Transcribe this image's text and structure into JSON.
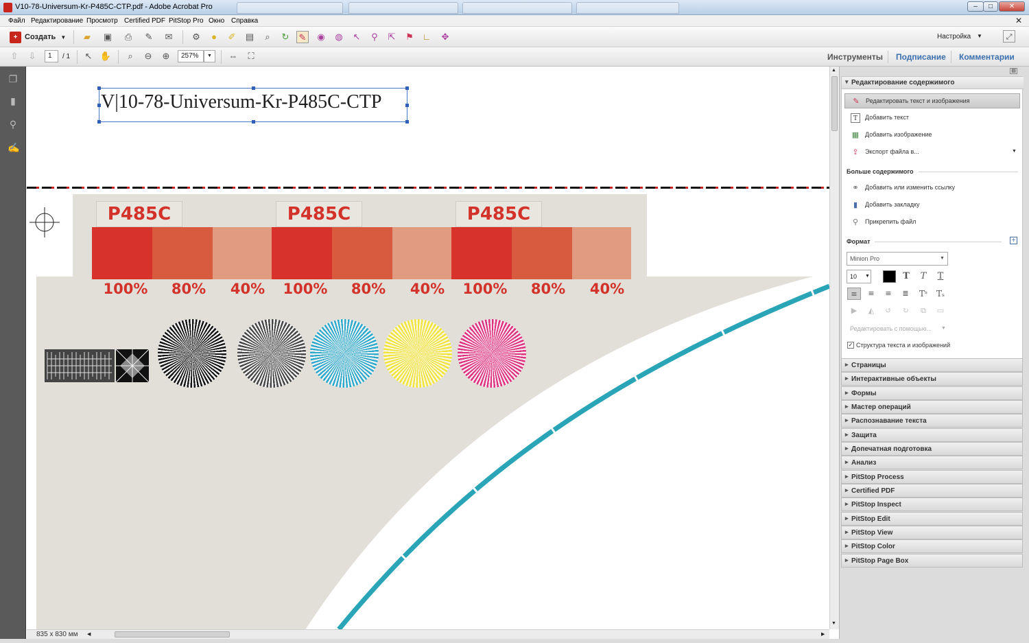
{
  "window": {
    "title": "V10-78-Universum-Kr-P485C-CTP.pdf - Adobe Acrobat Pro",
    "tabs": [
      "",
      "",
      "",
      ""
    ],
    "controls": [
      "–",
      "□",
      "✕"
    ]
  },
  "menu": [
    "Файл",
    "Редактирование",
    "Просмотр",
    "Certified PDF",
    "PitStop Pro",
    "Окно",
    "Справка"
  ],
  "toolbar": {
    "create_label": "Создать",
    "settings_label": "Настройка",
    "page_current": "1",
    "page_total": "/ 1",
    "zoom": "257%"
  },
  "top_tabs": {
    "tools": "Инструменты",
    "sign": "Подписание",
    "comment": "Комментарии"
  },
  "document": {
    "title_text": "V|10-78-Universum-Kr-P485C-CTP",
    "swatch_labels": [
      "P485C",
      "P485C",
      "P485C"
    ],
    "percentages": [
      "100%",
      "80%",
      "40%",
      "100%",
      "80%",
      "40%",
      "100%",
      "80%",
      "40%"
    ],
    "page_size": "835 x 830 мм",
    "colors": {
      "p100": "#d7332c",
      "p80": "#d95b3f",
      "p40": "#e19b80",
      "cyan": "#2aa9cc",
      "yellow": "#f0e33a",
      "magenta": "#e0317f",
      "curve": "#2aa5b8"
    }
  },
  "panel": {
    "header": "Редактирование содержимого",
    "items": [
      {
        "label": "Редактировать текст и изображения",
        "icon": "edit-text-image-icon"
      },
      {
        "label": "Добавить текст",
        "icon": "add-text-icon"
      },
      {
        "label": "Добавить изображение",
        "icon": "add-image-icon"
      },
      {
        "label": "Экспорт файла в...",
        "icon": "export-icon"
      }
    ],
    "more_header": "Больше содержимого",
    "more_items": [
      {
        "label": "Добавить или изменить ссылку",
        "icon": "link-icon"
      },
      {
        "label": "Добавить закладку",
        "icon": "bookmark-icon"
      },
      {
        "label": "Прикрепить файл",
        "icon": "attach-icon"
      }
    ],
    "format_header": "Формат",
    "font_name": "Minion Pro",
    "font_size": "10",
    "edit_with": "Редактировать с помощью...",
    "structure_checkbox": "Структура текста и изображений",
    "sections": [
      "Страницы",
      "Интерактивные объекты",
      "Формы",
      "Мастер операций",
      "Распознавание текста",
      "Защита",
      "Допечатная подготовка",
      "Анализ",
      "PitStop Process",
      "Certified PDF",
      "PitStop Inspect",
      "PitStop Edit",
      "PitStop View",
      "PitStop Color",
      "PitStop Page Box"
    ]
  }
}
